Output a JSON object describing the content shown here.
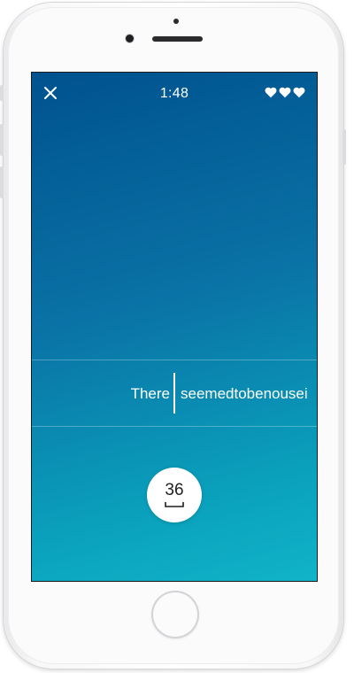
{
  "header": {
    "timer": "1:48",
    "lives": 3,
    "close_icon": "close-icon",
    "life_icon": "heart-icon"
  },
  "reader": {
    "previous_word": "There",
    "next_text": "seemedtobenousei"
  },
  "counter": {
    "value": "36",
    "icon": "space-underscore-icon"
  },
  "colors": {
    "gradient_top": "#00528e",
    "gradient_bottom": "#10b4c8",
    "text": "#ffffff"
  }
}
